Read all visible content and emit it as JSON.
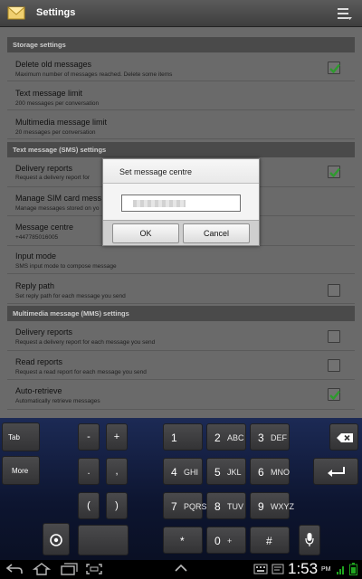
{
  "app": {
    "title": "Settings",
    "icon": "envelope-icon",
    "menu_icon": "menu-icon"
  },
  "sections": [
    {
      "header": "Storage settings"
    },
    {
      "header": "Text message (SMS) settings"
    },
    {
      "header": "Multimedia message (MMS) settings"
    }
  ],
  "items": [
    {
      "title": "Delete old messages",
      "subtitle": "Maximum number of messages reached. Delete some items",
      "checkbox": true,
      "checked": true
    },
    {
      "title": "Text message limit",
      "subtitle": "200 messages per conversation",
      "checkbox": false
    },
    {
      "title": "Multimedia message limit",
      "subtitle": "20 messages per conversation",
      "checkbox": false
    },
    {
      "title": "Delivery reports",
      "subtitle": "Request a delivery report for",
      "checkbox": true,
      "checked": true
    },
    {
      "title": "Manage SIM card mess",
      "subtitle": "Manage messages stored on yo",
      "checkbox": false
    },
    {
      "title": "Message centre",
      "subtitle": "+447785016005",
      "checkbox": false
    },
    {
      "title": "Input mode",
      "subtitle": "SMS input mode to compose message",
      "checkbox": false
    },
    {
      "title": "Reply path",
      "subtitle": "Set reply path for each message you send",
      "checkbox": true,
      "checked": false
    },
    {
      "title": "Delivery reports",
      "subtitle": "Request a delivery report for each message you send",
      "checkbox": true,
      "checked": false
    },
    {
      "title": "Read reports",
      "subtitle": "Request a read report for each message you send",
      "checkbox": true,
      "checked": false
    },
    {
      "title": "Auto-retrieve",
      "subtitle": "Automatically retrieve messages",
      "checkbox": true,
      "checked": true
    }
  ],
  "dialog": {
    "title": "Set message centre",
    "input_value": "",
    "ok_label": "OK",
    "cancel_label": "Cancel"
  },
  "keyboard": {
    "tab": "Tab",
    "more": "More",
    "symbols": [
      "-",
      "+",
      ".",
      ",",
      "(",
      ")"
    ],
    "numbers": [
      {
        "digit": "1",
        "letters": ""
      },
      {
        "digit": "2",
        "letters": "ABC"
      },
      {
        "digit": "3",
        "letters": "DEF"
      },
      {
        "digit": "4",
        "letters": "GHI"
      },
      {
        "digit": "5",
        "letters": "JKL"
      },
      {
        "digit": "6",
        "letters": "MNO"
      },
      {
        "digit": "7",
        "letters": "PQRS"
      },
      {
        "digit": "8",
        "letters": "TUV"
      },
      {
        "digit": "9",
        "letters": "WXYZ"
      },
      {
        "digit": "*",
        "letters": ""
      },
      {
        "digit": "0",
        "letters": "+"
      },
      {
        "digit": "#",
        "letters": ""
      }
    ]
  },
  "status": {
    "time": "1:53",
    "ampm": "PM"
  },
  "colors": {
    "checkbox_green": "#2e9a2e",
    "keyboard_bg": "#101a3a",
    "dim_bg": "#6a6a6a"
  }
}
